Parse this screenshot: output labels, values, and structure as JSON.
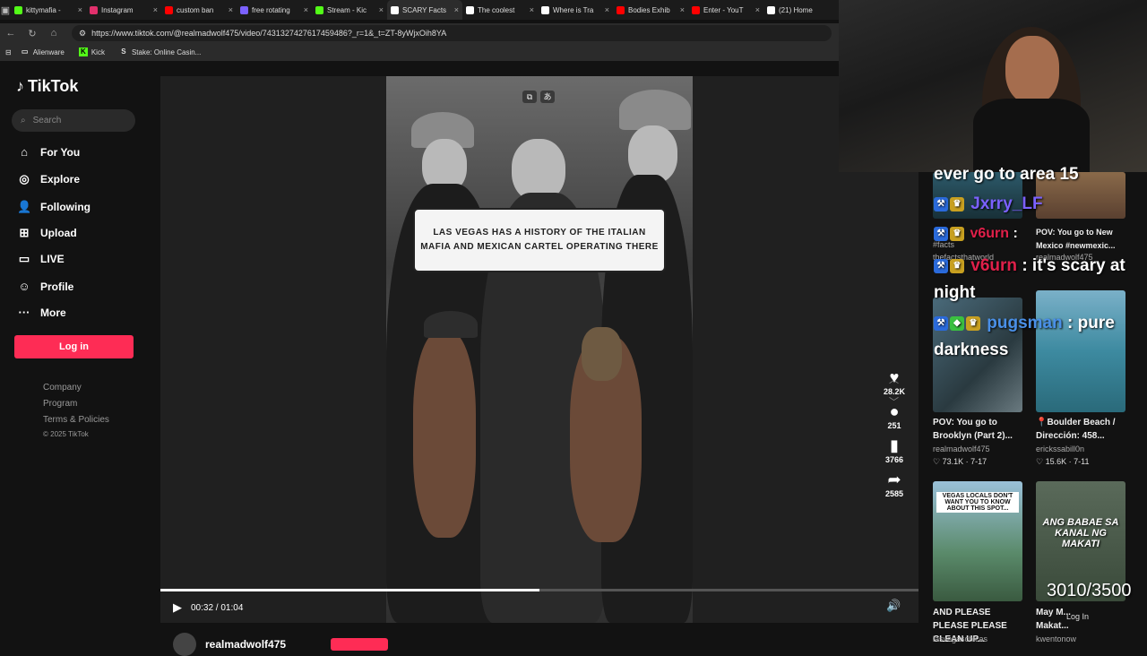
{
  "browser": {
    "tabs": [
      {
        "title": "kittymafia -",
        "color": "#53fc18"
      },
      {
        "title": "Instagram",
        "color": "#e1306c"
      },
      {
        "title": "custom ban",
        "color": "#ff0000"
      },
      {
        "title": "free rotating",
        "color": "#7b61ff"
      },
      {
        "title": "Stream - Kic",
        "color": "#53fc18"
      },
      {
        "title": "SCARY Facts",
        "color": "#ffffff"
      },
      {
        "title": "The coolest",
        "color": "#ffffff"
      },
      {
        "title": "Where is Tra",
        "color": "#ffffff"
      },
      {
        "title": "Bodies Exhib",
        "color": "#ff0000"
      },
      {
        "title": "Enter - YouT",
        "color": "#ff0000"
      },
      {
        "title": "(21) Home",
        "color": "#ffffff"
      }
    ],
    "active_tab_index": 5,
    "url": "https://www.tiktok.com/@realmadwolf475/video/7431327427617459486?_r=1&_t=ZT-8yWjxOih8YA",
    "bookmarks": [
      {
        "label": "Alienware"
      },
      {
        "label": "Kick"
      },
      {
        "label": "Stake: Online Casin..."
      }
    ]
  },
  "sidebar": {
    "logo": "TikTok",
    "search_placeholder": "Search",
    "nav": [
      {
        "label": "For You",
        "icon": "home-icon"
      },
      {
        "label": "Explore",
        "icon": "compass-icon"
      },
      {
        "label": "Following",
        "icon": "following-icon"
      },
      {
        "label": "Upload",
        "icon": "upload-icon"
      },
      {
        "label": "LIVE",
        "icon": "live-icon"
      },
      {
        "label": "Profile",
        "icon": "profile-icon"
      },
      {
        "label": "More",
        "icon": "more-icon"
      }
    ],
    "login_label": "Log in",
    "footer": [
      "Company",
      "Program",
      "Terms & Policies",
      "© 2025 TikTok"
    ]
  },
  "video": {
    "caption": "LAS VEGAS HAS A HISTORY OF THE ITALIAN MAFIA AND MEXICAN CARTEL OPERATING THERE",
    "time": "00:32 / 01:04",
    "progress": 0.5,
    "likes": "28.2K",
    "comments": "251",
    "saves": "3766",
    "shares": "2585",
    "author": "realmadwolf475"
  },
  "chat": [
    {
      "text": "ever go to area 15"
    },
    {
      "user": "Jxrry_LF",
      "msg": ""
    },
    {
      "user": "v6urn",
      "msg": ": it's scary at"
    },
    {
      "text": "night"
    },
    {
      "user": "pugsman",
      "msg": ": pure"
    },
    {
      "text": "darkness"
    }
  ],
  "chat_extra_user": "v6urn",
  "chat_extra_msg": ":",
  "recommendations": [
    {
      "title": "POV: You go to Brooklyn (Part 2)...",
      "author": "realmadwolf475",
      "likes": "73.1K",
      "date": "7-17"
    },
    {
      "title": "📍Boulder Beach / Dirección: 458...",
      "author": "erickssabill0n",
      "likes": "15.6K",
      "date": "7-11"
    },
    {
      "title": "AND PLEASE PLEASE PLEASE CLEAN UP...",
      "author": "lasvegaschicas"
    },
    {
      "title": "May M... Makat...",
      "author": "kwentonow"
    }
  ],
  "card_overlays": [
    "VEGAS LOCALS DON'T WANT YOU TO KNOW ABOUT THIS SPOT...",
    "ANG BABAE SA KANAL NG MAKATI"
  ],
  "partial_cards": [
    "POV: You go to New Mexico #newmexic...",
    "#facts",
    "thefactsthatworld",
    "realmadwolf475"
  ],
  "counter": "3010/3500",
  "right_login": "Log In"
}
